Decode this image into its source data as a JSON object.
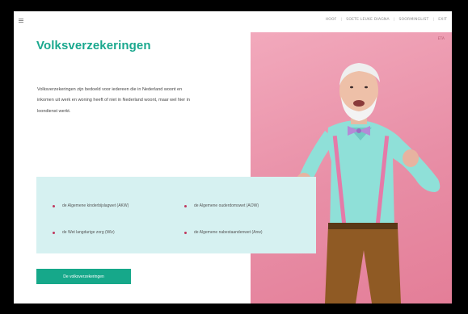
{
  "topnav": {
    "items": [
      "HOOF",
      "SOETE LEUKE DIAGNA",
      "SOORMINGLIST",
      "EXIT"
    ]
  },
  "hero": {
    "title": "Volksverzekeringen",
    "intro": "Volksverzekeringen zijn bedoeld voor iedereen die in Nederland woont en inkomen uit werk en woning heeft of niet in Nederland woont, maar wel hier in loondienst werkt.",
    "photo_tag": "ETA"
  },
  "insurances": {
    "items": [
      "de Algemene kinderbijslagwet (AKW)",
      "de Algemene ouderdomswet (AOW)",
      "de Wet langdurige zorg (Wlz)",
      "de Algemene nabestaandenwet (Anw)"
    ]
  },
  "cta": {
    "label": "De volksverzekeringen"
  },
  "colors": {
    "accent": "#1aa88e",
    "button": "#16a88a",
    "card": "#d6f1f1",
    "bullet": "#c0385e",
    "photo_bg": "#ee9bb2"
  }
}
